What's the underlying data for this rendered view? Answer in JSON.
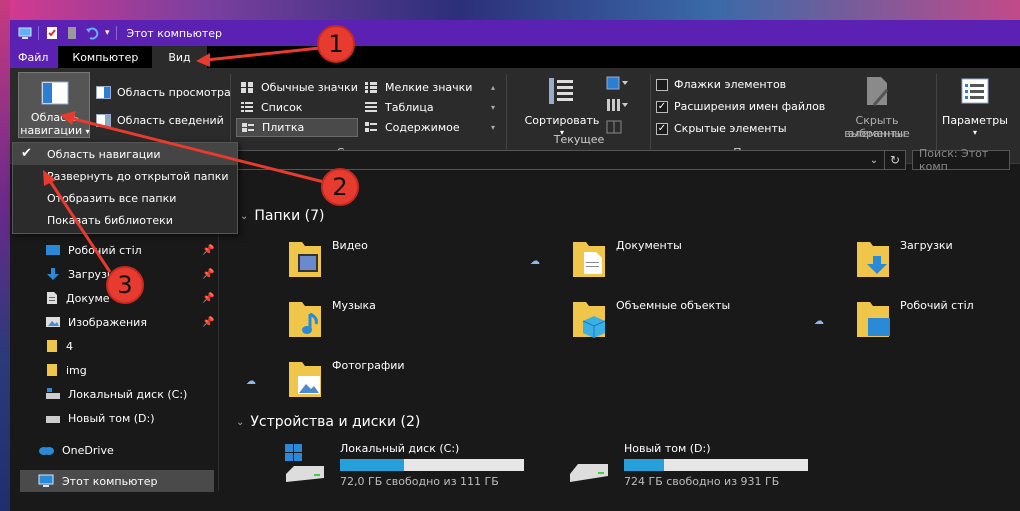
{
  "window": {
    "title": "Этот компьютер"
  },
  "menu": {
    "tabs": [
      "Файл",
      "Компьютер",
      "Вид"
    ]
  },
  "ribbon": {
    "panes": {
      "nav_pane_label_1": "Область",
      "nav_pane_label_2": "навигации",
      "preview": "Область просмотра",
      "details": "Область сведений"
    },
    "layout": {
      "items": [
        "Обычные значки",
        "Мелкие значки",
        "Список",
        "Таблица",
        "Плитка",
        "Содержимое"
      ],
      "selected": "Плитка",
      "group_label": "Структура"
    },
    "current_view": {
      "sort_label": "Сортировать",
      "group_label": "Текущее представление"
    },
    "show_hide": {
      "checkboxes": [
        {
          "label": "Флажки элементов",
          "checked": false
        },
        {
          "label": "Расширения имен файлов",
          "checked": true
        },
        {
          "label": "Скрытые элементы",
          "checked": true
        }
      ],
      "hide_selected_1": "Скрыть выбранные",
      "hide_selected_2": "элементы",
      "group_label": "Показать или скрыть"
    },
    "options_label": "Параметры"
  },
  "dropdown": {
    "items": [
      "Область навигации",
      "Развернуть до открытой папки",
      "Отобразить все папки",
      "Показать библиотеки"
    ],
    "checked_index": 0
  },
  "address": {
    "search_placeholder": "Поиск: Этот комп"
  },
  "nav": {
    "items": [
      {
        "label": "Робочий стіл",
        "pinned": true
      },
      {
        "label": "Загрузки",
        "pinned": true
      },
      {
        "label": "Докуме",
        "pinned": true
      },
      {
        "label": "Изображения",
        "pinned": true
      },
      {
        "label": "4",
        "pinned": false
      },
      {
        "label": "img",
        "pinned": false
      },
      {
        "label": "Локальный диск (C:)",
        "pinned": false
      },
      {
        "label": "Новый том (D:)",
        "pinned": false
      }
    ],
    "onedrive": "OneDrive",
    "this_pc": "Этот компьютер"
  },
  "content": {
    "folders_title": "Папки (7)",
    "folders": [
      "Видео",
      "Документы",
      "Загрузки",
      "Музыка",
      "Объемные объекты",
      "Робочий стіл",
      "Фотографии"
    ],
    "devices_title": "Устройства и диски (2)",
    "drives": [
      {
        "name": "Локальный диск (C:)",
        "free": "72,0 ГБ свободно из 111 ГБ",
        "used_fraction": 0.35
      },
      {
        "name": "Новый том (D:)",
        "free": "724 ГБ свободно из 931 ГБ",
        "used_fraction": 0.22
      }
    ]
  },
  "annotations": {
    "badges": [
      "1",
      "2",
      "3"
    ]
  },
  "colors": {
    "titlebar": "#5a21b2",
    "accent_bar": "#26a0da",
    "annotation": "#e63b2e"
  }
}
